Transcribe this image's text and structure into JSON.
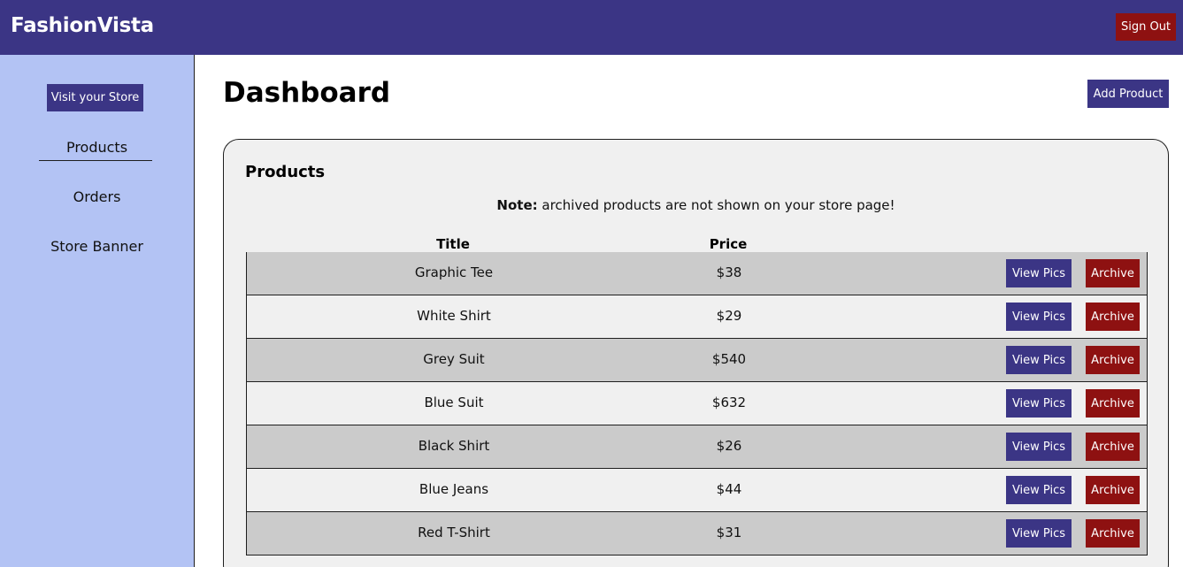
{
  "header": {
    "brand": "FashionVista",
    "sign_out_label": "Sign Out"
  },
  "sidebar": {
    "visit_store_label": "Visit your Store",
    "items": [
      {
        "label": "Products",
        "active": true
      },
      {
        "label": "Orders",
        "active": false
      },
      {
        "label": "Store Banner",
        "active": false
      }
    ]
  },
  "main": {
    "title": "Dashboard",
    "add_product_label": "Add Product",
    "panel": {
      "title": "Products",
      "note_label": "Note:",
      "note_text": " archived products are not shown on your store page!",
      "columns": [
        "Title",
        "Price"
      ],
      "view_label": "View Pics",
      "archive_label": "Archive",
      "products": [
        {
          "title": "Graphic Tee",
          "price": "$38"
        },
        {
          "title": "White Shirt",
          "price": "$29"
        },
        {
          "title": "Grey Suit",
          "price": "$540"
        },
        {
          "title": "Blue Suit",
          "price": "$632"
        },
        {
          "title": "Black Shirt",
          "price": "$26"
        },
        {
          "title": "Blue Jeans",
          "price": "$44"
        },
        {
          "title": "Red T-Shirt",
          "price": "$31"
        }
      ]
    }
  },
  "colors": {
    "primary": "#3b3585",
    "danger": "#8e1111",
    "sidebar_bg": "#b3c3f4",
    "panel_bg": "#f0f0f0",
    "row_alt_bg": "#cbcbcb"
  }
}
